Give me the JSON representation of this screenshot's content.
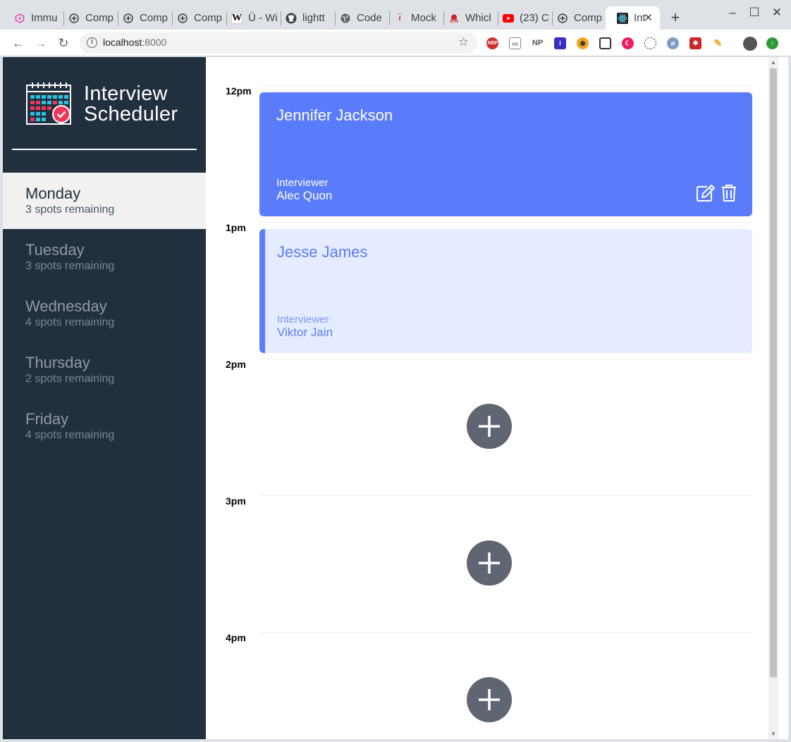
{
  "browser": {
    "tabs": [
      {
        "title": "Immu",
        "icon": "graphql-icon"
      },
      {
        "title": "Comp",
        "icon": "compass-icon"
      },
      {
        "title": "Comp",
        "icon": "compass-icon"
      },
      {
        "title": "Comp",
        "icon": "compass-icon"
      },
      {
        "title": "Ü - Wi",
        "icon": "wikipedia-icon"
      },
      {
        "title": "lightt",
        "icon": "github-icon"
      },
      {
        "title": "Code",
        "icon": "globe-icon"
      },
      {
        "title": "Mock",
        "icon": "mock-icon"
      },
      {
        "title": "Whicl",
        "icon": "octopus-icon"
      },
      {
        "title": "(23) C",
        "icon": "youtube-icon"
      },
      {
        "title": "Comp",
        "icon": "compass-icon"
      },
      {
        "title": "Int",
        "icon": "react-icon"
      }
    ],
    "url_host": "localhost",
    "url_port": ":8000"
  },
  "app": {
    "brand_line1": "Interview",
    "brand_line2": "Scheduler",
    "days": [
      {
        "name": "Monday",
        "spots": "3 spots remaining",
        "selected": true
      },
      {
        "name": "Tuesday",
        "spots": "3 spots remaining",
        "selected": false
      },
      {
        "name": "Wednesday",
        "spots": "4 spots remaining",
        "selected": false
      },
      {
        "name": "Thursday",
        "spots": "2 spots remaining",
        "selected": false
      },
      {
        "name": "Friday",
        "spots": "4 spots remaining",
        "selected": false
      }
    ],
    "appointments": [
      {
        "time": "12pm",
        "student": "Jennifer Jackson",
        "interviewer_label": "Interviewer",
        "interviewer": "Alec Quon",
        "style": "booked"
      },
      {
        "time": "1pm",
        "student": "Jesse James",
        "interviewer_label": "Interviewer",
        "interviewer": "Viktor Jain",
        "style": "light"
      },
      {
        "time": "2pm"
      },
      {
        "time": "3pm"
      },
      {
        "time": "4pm"
      }
    ],
    "colors": {
      "sidebar": "#222f3e",
      "accent": "#5a7cfa",
      "accent_light": "#e5ecff",
      "add_button": "#5f6571"
    }
  }
}
